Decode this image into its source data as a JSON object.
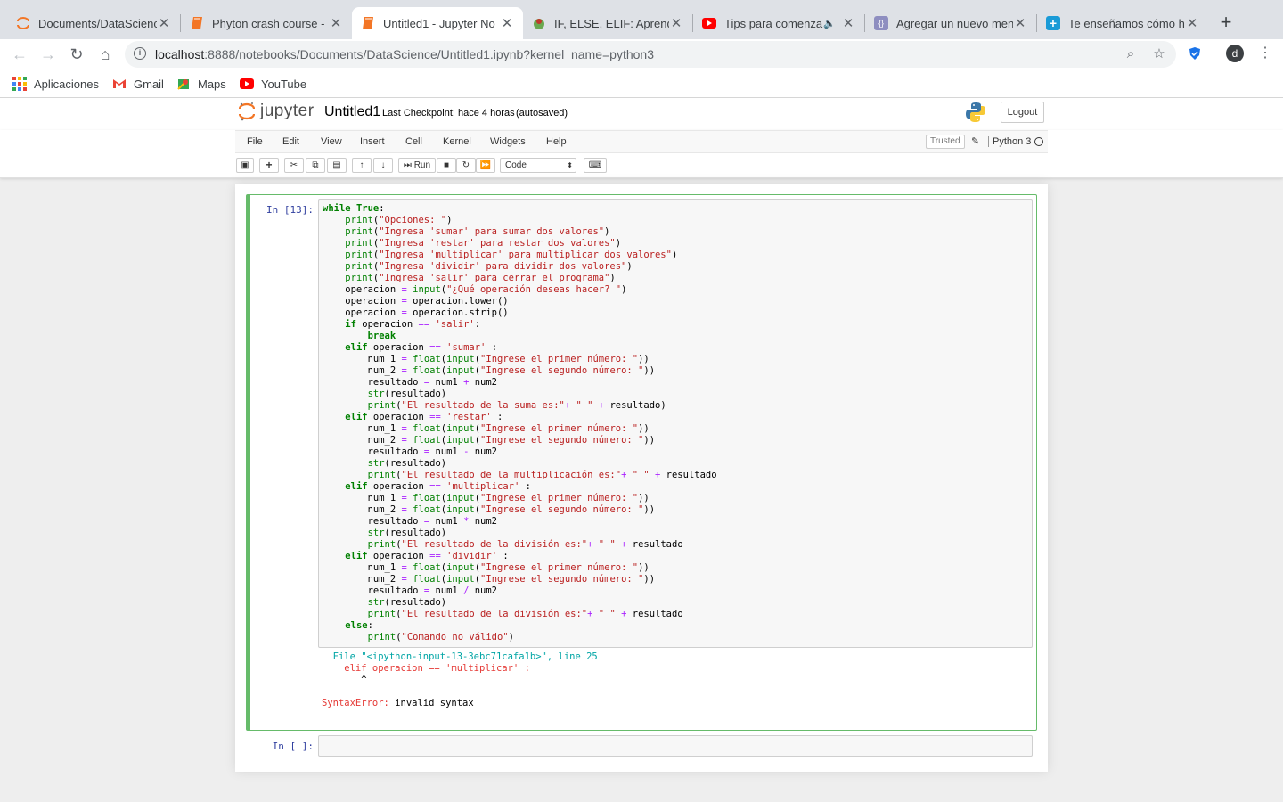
{
  "browser": {
    "tabs": [
      {
        "title": "Documents/DataScienc",
        "icon": "jupyter-icon"
      },
      {
        "title": "Phyton crash course -",
        "icon": "notebook-icon"
      },
      {
        "title": "Untitled1 - Jupyter No",
        "icon": "notebook-icon",
        "active": true
      },
      {
        "title": "IF, ELSE, ELIF: Aprend",
        "icon": "site-icon"
      },
      {
        "title": "Tips para comenza",
        "icon": "youtube-icon"
      },
      {
        "title": "Agregar un nuevo men",
        "icon": "site-icon"
      },
      {
        "title": "Te enseñamos cómo h",
        "icon": "plus-icon"
      }
    ],
    "url_host": "localhost",
    "url_path": ":8888/notebooks/Documents/DataScience/Untitled1.ipynb?kernel_name=python3",
    "avatar_letter": "d",
    "bookmarks": [
      {
        "label": "Aplicaciones"
      },
      {
        "label": "Gmail"
      },
      {
        "label": "Maps"
      },
      {
        "label": "YouTube"
      }
    ]
  },
  "jupyter": {
    "logo_text": "jupyter",
    "notebook_name": "Untitled1",
    "checkpoint": "Last Checkpoint: hace 4 horas",
    "autosaved": "(autosaved)",
    "logout": "Logout",
    "menu": [
      "File",
      "Edit",
      "View",
      "Insert",
      "Cell",
      "Kernel",
      "Widgets",
      "Help"
    ],
    "trusted": "Trusted",
    "kernel": "Python 3",
    "run_label": "Run",
    "cell_type": "Code"
  },
  "cells": {
    "prompt_1": "In [13]:",
    "prompt_2": "In [ ]:",
    "error_file_line": "  File \"<ipython-input-13-3ebc71cafa1b>\", line 25",
    "error_code_line": "    elif operacion == 'multiplicar' :",
    "error_caret": "       ^",
    "error_type": "SyntaxError:",
    "error_msg": " invalid syntax"
  }
}
